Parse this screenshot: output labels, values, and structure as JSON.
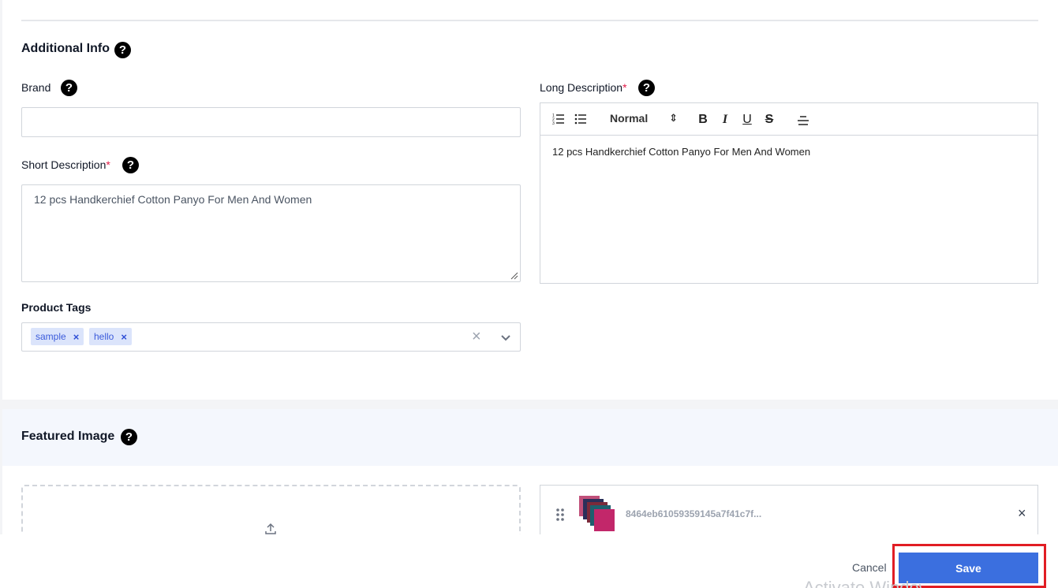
{
  "additional_info": {
    "title": "Additional Info",
    "help": "?"
  },
  "brand": {
    "label": "Brand",
    "value": "",
    "help": "?"
  },
  "short_description": {
    "label": "Short Description",
    "required_mark": "*",
    "value": "12 pcs Handkerchief Cotton Panyo For Men And Women",
    "help": "?"
  },
  "long_description": {
    "label": "Long Description",
    "required_mark": "*",
    "help": "?",
    "toolbar": {
      "format_value": "Normal",
      "format_arrows": "⇕",
      "bold": "B",
      "italic": "I",
      "underline": "U",
      "strike": "S"
    },
    "content": "12 pcs Handkerchief Cotton Panyo For Men And Women"
  },
  "product_tags": {
    "label": "Product Tags",
    "tags": [
      "sample",
      "hello"
    ],
    "tag_remove": "×",
    "clear": "×",
    "chevron": "⌄"
  },
  "featured_image": {
    "title": "Featured Image",
    "help": "?",
    "file_name": "8464eb61059359145a7f41c7f...",
    "remove": "×"
  },
  "footer": {
    "cancel_label": "Cancel",
    "save_label": "Save",
    "watermark": "Activate Windows"
  },
  "colors": {
    "primary": "#3b6fdf",
    "required": "#e11d48",
    "highlight": "#e11d24",
    "tag_bg": "#dbe4fb"
  }
}
